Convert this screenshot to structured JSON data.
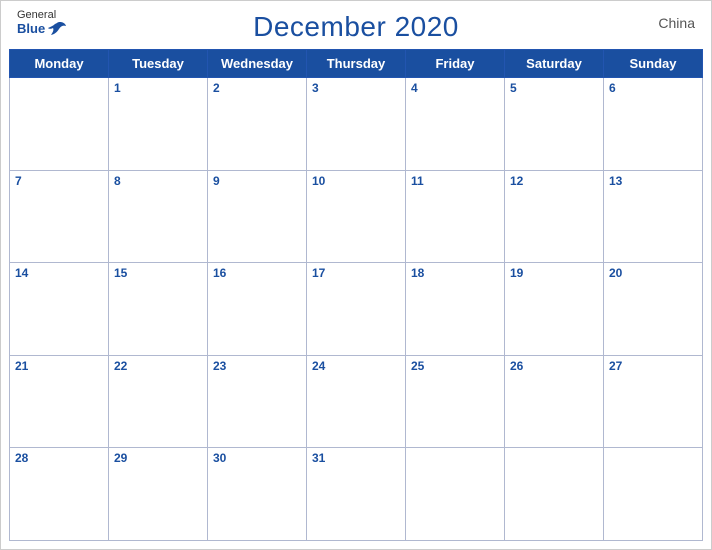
{
  "header": {
    "logo_general": "General",
    "logo_blue": "Blue",
    "title": "December 2020",
    "country": "China"
  },
  "weekdays": [
    "Monday",
    "Tuesday",
    "Wednesday",
    "Thursday",
    "Friday",
    "Saturday",
    "Sunday"
  ],
  "weeks": [
    [
      null,
      1,
      2,
      3,
      4,
      5,
      6
    ],
    [
      7,
      8,
      9,
      10,
      11,
      12,
      13
    ],
    [
      14,
      15,
      16,
      17,
      18,
      19,
      20
    ],
    [
      21,
      22,
      23,
      24,
      25,
      26,
      27
    ],
    [
      28,
      29,
      30,
      31,
      null,
      null,
      null
    ]
  ]
}
